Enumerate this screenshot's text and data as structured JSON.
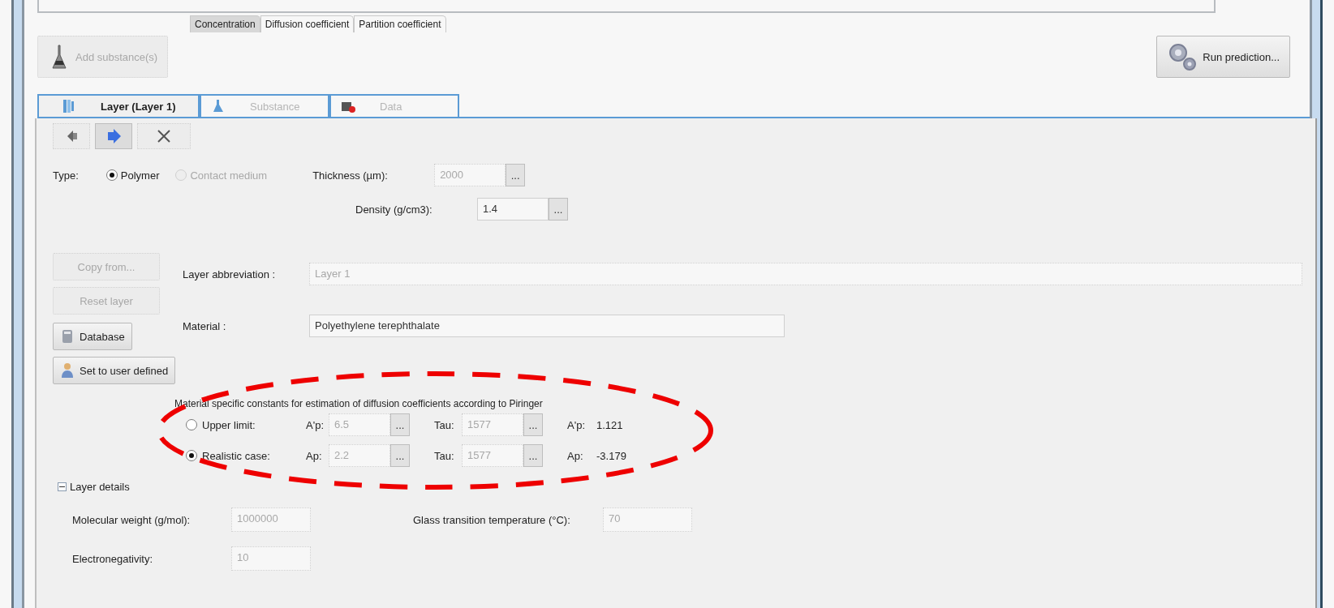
{
  "top_tabs": [
    {
      "label": "Concentration",
      "selected": true
    },
    {
      "label": "Diffusion coefficient",
      "selected": false
    },
    {
      "label": "Partition coefficient",
      "selected": false
    }
  ],
  "add_substance_button": {
    "label": "Add substance(s)",
    "disabled": true
  },
  "run_prediction_button": {
    "label": "Run prediction...",
    "disabled": false
  },
  "layer_tabs": [
    {
      "label": "Layer (Layer 1)",
      "kind": "layer",
      "selected": true,
      "disabled": false
    },
    {
      "label": "Substance",
      "kind": "substance",
      "selected": false,
      "disabled": true
    },
    {
      "label": "Data",
      "kind": "data",
      "selected": false,
      "disabled": true
    }
  ],
  "toolbar_buttons": [
    {
      "kind": "previous",
      "pressed": false
    },
    {
      "kind": "next",
      "pressed": true
    },
    {
      "kind": "delete",
      "pressed": false
    }
  ],
  "type": {
    "label": "Type:",
    "options": [
      {
        "label": "Polymer",
        "selected": true,
        "disabled": false
      },
      {
        "label": "Contact medium",
        "selected": false,
        "disabled": true
      }
    ]
  },
  "thickness": {
    "label": "Thickness (µm):",
    "value": "2000",
    "disabled": true,
    "button": "..."
  },
  "density": {
    "label": "Density (g/cm3):",
    "value": "1.4",
    "disabled": false,
    "button": "..."
  },
  "side_buttons": [
    {
      "label": "Copy from...",
      "kind": "plain",
      "disabled": true
    },
    {
      "label": "Reset layer",
      "kind": "plain",
      "disabled": true
    },
    {
      "label": "Database",
      "kind": "database",
      "disabled": false
    },
    {
      "label": "Set to user defined",
      "kind": "user",
      "disabled": false
    }
  ],
  "layer_abbreviation": {
    "label": "Layer abbreviation :",
    "value": "Layer 1",
    "disabled": true
  },
  "material": {
    "label": "Material :",
    "value": "Polyethylene terephthalate",
    "disabled": false
  },
  "constants": {
    "heading": "Material specific constants for estimation of diffusion coefficients according to Piringer",
    "rows": [
      {
        "label": "Upper limit:",
        "selected": false,
        "param_label": "A'p:",
        "param_value": "6.5",
        "param_button": "...",
        "tau_label": "Tau:",
        "tau_value": "1577",
        "tau_button": "...",
        "result_label": "A'p:",
        "result_value": "1.121"
      },
      {
        "label": "Realistic case:",
        "selected": true,
        "param_label": "Ap:",
        "param_value": "2.2",
        "param_button": "...",
        "tau_label": "Tau:",
        "tau_value": "1577",
        "tau_button": "...",
        "result_label": "Ap:",
        "result_value": "-3.179"
      }
    ]
  },
  "layer_details": {
    "label": "Layer details",
    "expanded": true,
    "fields": [
      {
        "label": "Molecular weight (g/mol):",
        "value": "1000000"
      },
      {
        "label": "Glass transition temperature (°C):",
        "value": "70"
      },
      {
        "label": "Electronegativity:",
        "value": "10"
      }
    ]
  }
}
